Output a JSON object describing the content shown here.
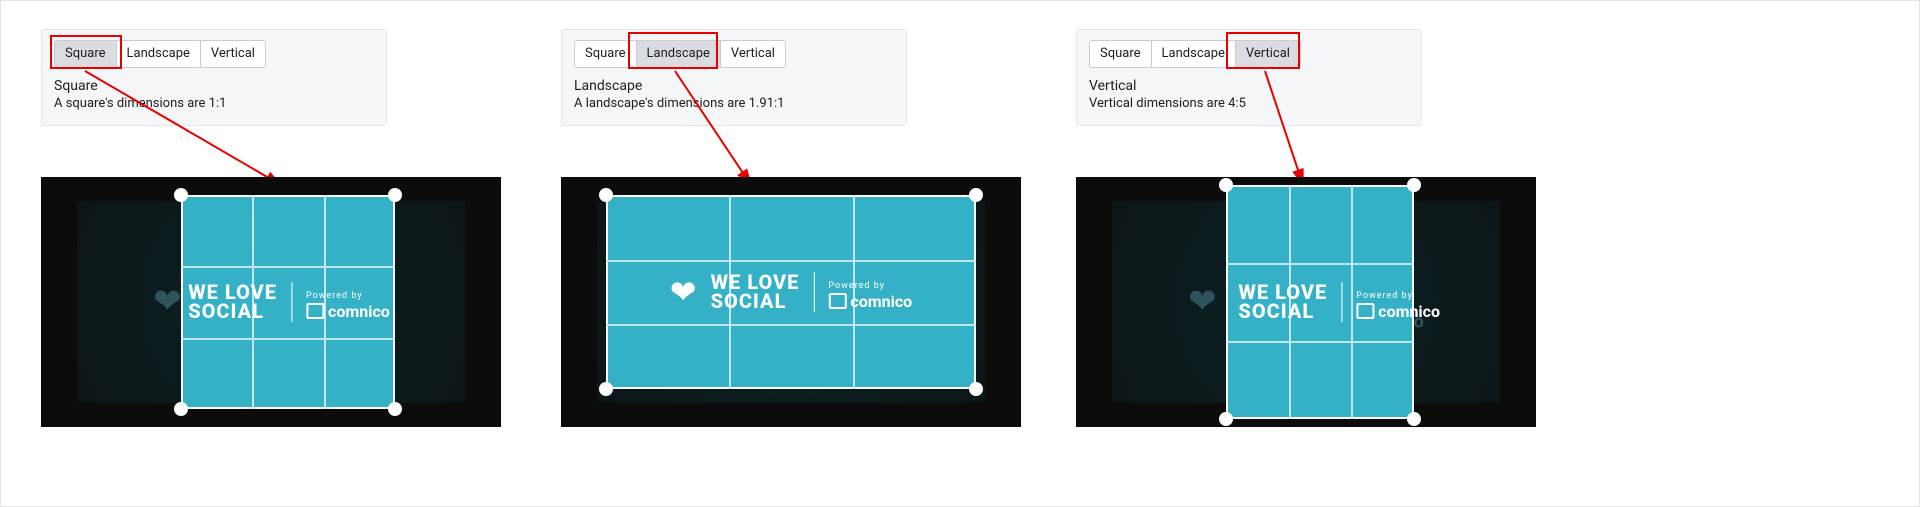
{
  "panes": [
    {
      "tabs": {
        "square": "Square",
        "landscape": "Landscape",
        "vertical": "Vertical",
        "active": "square"
      },
      "info_title": "Square",
      "info_desc": "A square's dimensions are 1:1",
      "crop_shape": "sq",
      "highlight_tab": "square"
    },
    {
      "tabs": {
        "square": "Square",
        "landscape": "Landscape",
        "vertical": "Vertical",
        "active": "landscape"
      },
      "info_title": "Landscape",
      "info_desc": "A landscape's dimensions are 1.91:1",
      "crop_shape": "ls",
      "highlight_tab": "landscape"
    },
    {
      "tabs": {
        "square": "Square",
        "landscape": "Landscape",
        "vertical": "Vertical",
        "active": "vertical"
      },
      "info_title": "Vertical",
      "info_desc": "Vertical dimensions are 4:5",
      "crop_shape": "vt",
      "highlight_tab": "vertical"
    }
  ],
  "brand": {
    "line1": "WE LOVE",
    "line2": "SOCIAL",
    "powered": "Powered by",
    "company": "comnico"
  }
}
